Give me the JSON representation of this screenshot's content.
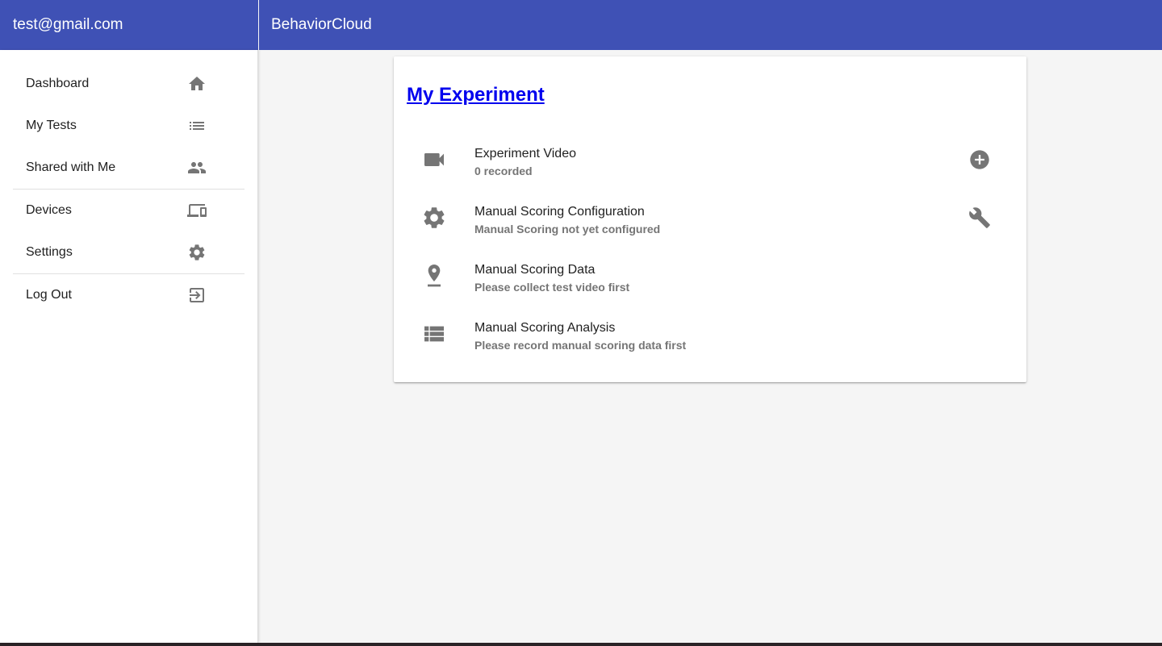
{
  "sidebar": {
    "user_email": "test@gmail.com",
    "items": [
      {
        "label": "Dashboard",
        "icon": "home-icon"
      },
      {
        "label": "My Tests",
        "icon": "list-icon"
      },
      {
        "label": "Shared with Me",
        "icon": "people-icon"
      },
      {
        "label": "Devices",
        "icon": "devices-icon"
      },
      {
        "label": "Settings",
        "icon": "gear-icon"
      },
      {
        "label": "Log Out",
        "icon": "logout-icon"
      }
    ]
  },
  "header": {
    "app_title": "BehaviorCloud"
  },
  "experiment": {
    "title": "My Experiment",
    "items": [
      {
        "primary": "Experiment Video",
        "secondary": "0 recorded",
        "icon": "videocam-icon",
        "action_icon": "add-circle-icon"
      },
      {
        "primary": "Manual Scoring Configuration",
        "secondary": "Manual Scoring not yet configured",
        "icon": "gear-icon",
        "action_icon": "wrench-icon"
      },
      {
        "primary": "Manual Scoring Data",
        "secondary": "Please collect test video first",
        "icon": "pin-icon"
      },
      {
        "primary": "Manual Scoring Analysis",
        "secondary": "Please record manual scoring data first",
        "icon": "list-view-icon"
      }
    ]
  },
  "colors": {
    "app_bar": "#3f51b5",
    "icon_gray": "#757575",
    "link": "#0000ee",
    "background": "#f5f5f5"
  }
}
